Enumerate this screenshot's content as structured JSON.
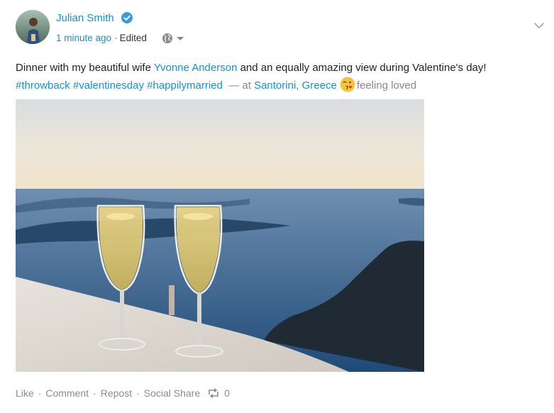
{
  "post": {
    "author": {
      "name": "Julian Smith",
      "verified": true,
      "avatar_icon": "person-avatar"
    },
    "meta": {
      "time": "1 minute ago",
      "edited": "Edited",
      "privacy_icon": "globe-icon"
    },
    "text": {
      "part1": "Dinner with my beautiful wife ",
      "mention": "Yvonne Anderson",
      "part2": " and an equally amazing view during Valentine's day!",
      "hashtags": [
        "#throwback",
        "#valentinesday",
        "#happilymarried"
      ],
      "at_prefix": "— at",
      "location_city": "Santorini",
      "location_country": "Greece",
      "feeling": "feeling loved",
      "feeling_icon": "kissing-face-emoji"
    },
    "image": {
      "subject": "two champagne glasses on a ledge overlooking the sea",
      "icon": "photo"
    },
    "actions": {
      "like": "Like",
      "comment": "Comment",
      "repost": "Repost",
      "social_share": "Social Share",
      "repost_count": "0",
      "separator": "·"
    },
    "colors": {
      "link": "#1a8fd0",
      "muted": "#888888",
      "text": "#222222",
      "verified": "#3b9ae1"
    }
  }
}
